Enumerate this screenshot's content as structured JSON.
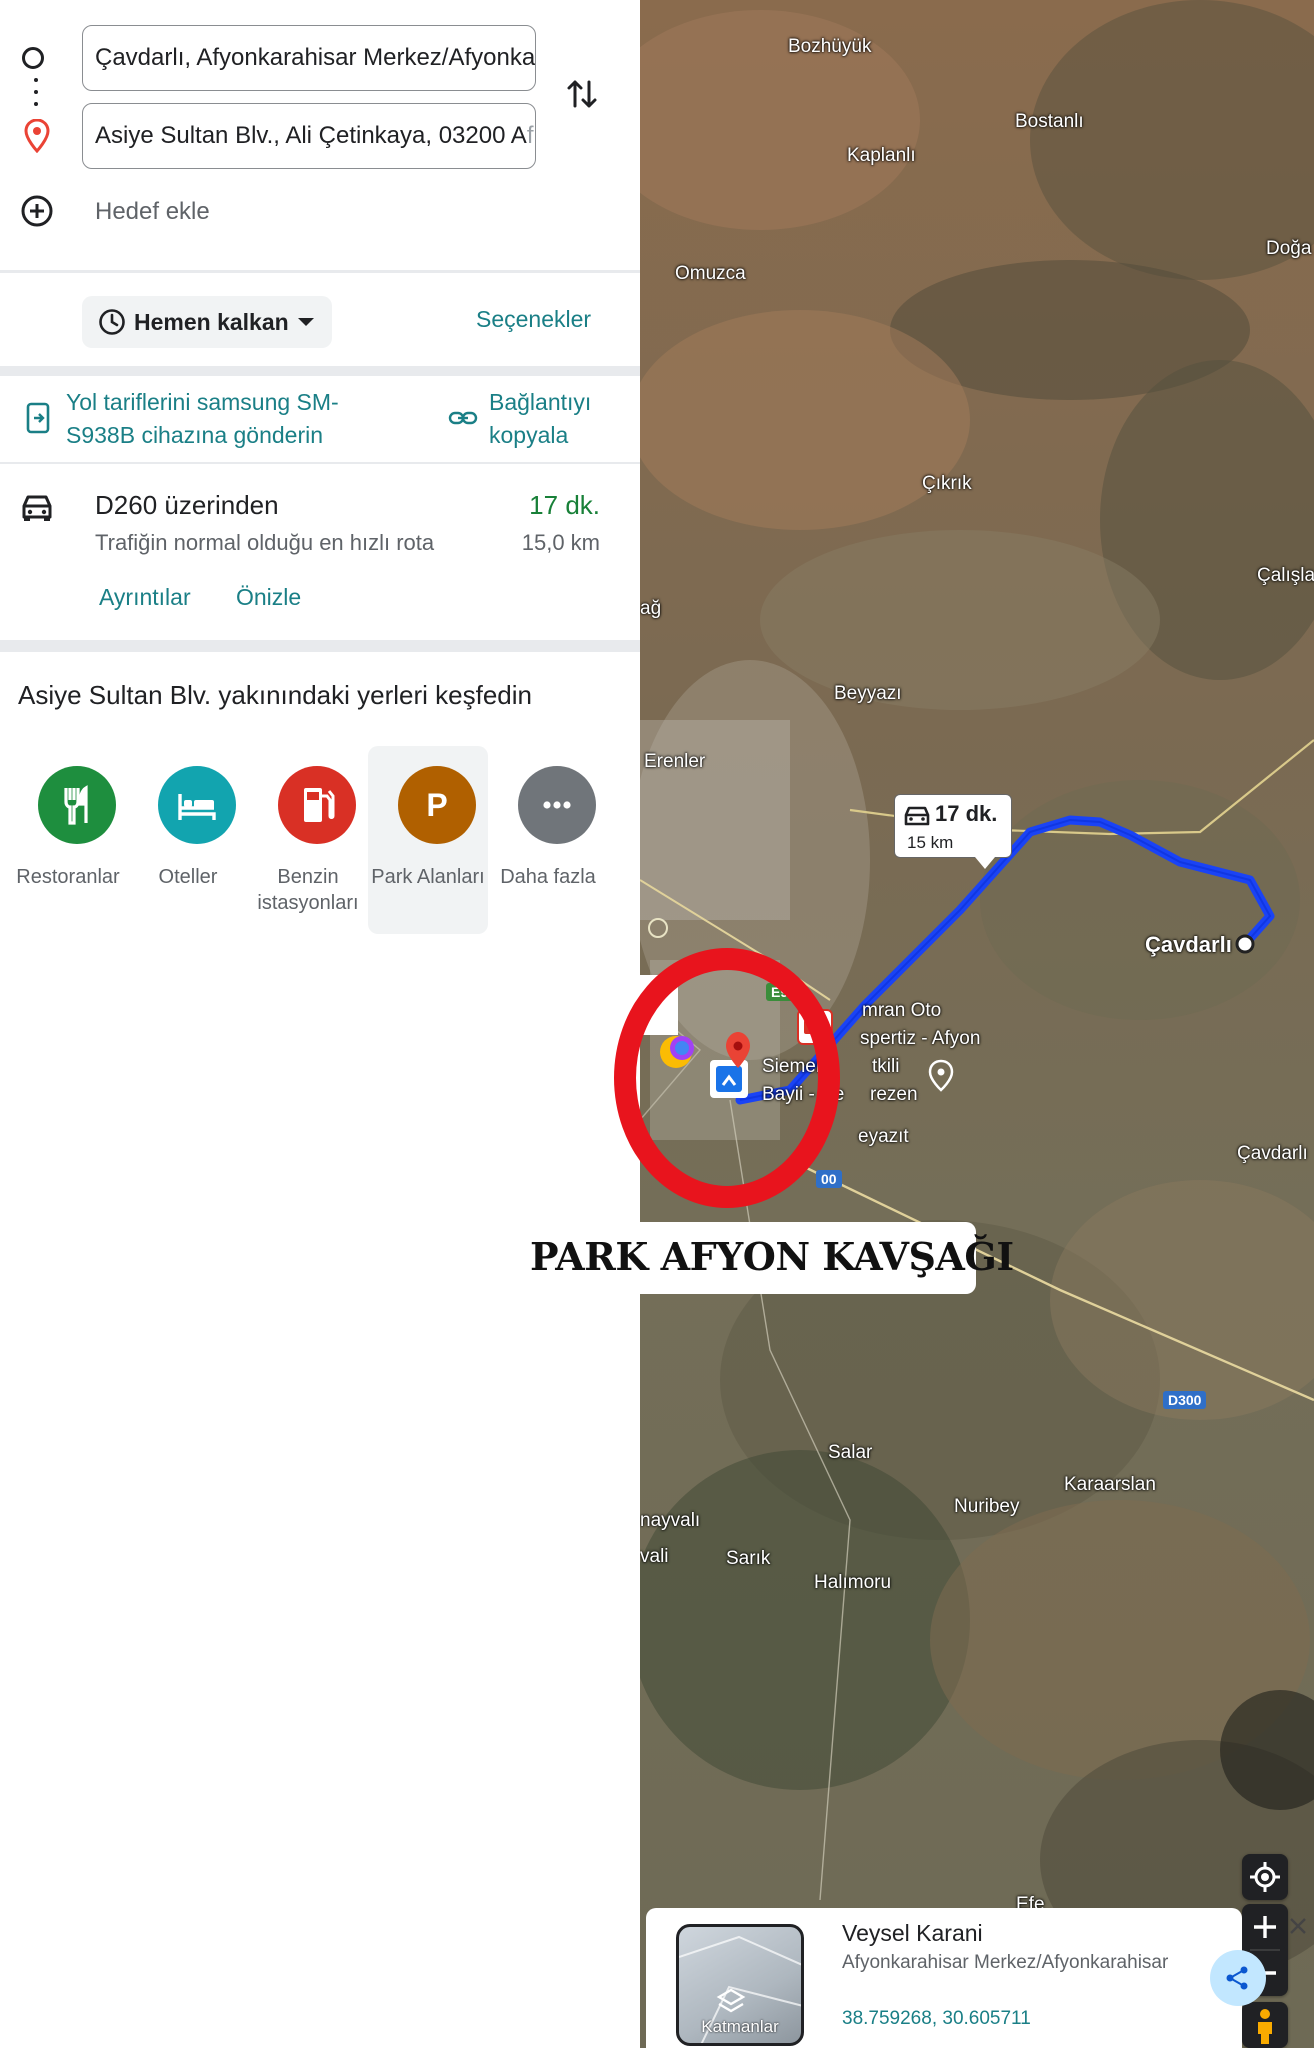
{
  "directions": {
    "origin_value": "Çavdarlı, Afyonkarahisar Merkez/Afyonka",
    "origin_fade": "ra",
    "destination_value": "Asiye Sultan Blv., Ali Çetinkaya, 03200 A",
    "destination_fade": "f",
    "add_destination_label": "Hedef ekle"
  },
  "departure": {
    "button_label": "Hemen kalkan",
    "options_label": "Seçenekler"
  },
  "share": {
    "send_label": "Yol tariflerini samsung SM-S938B cihazına gönderin",
    "copy_link_label": "Bağlantıyı kopyala"
  },
  "route": {
    "via": "D260 üzerinden",
    "duration": "17 dk.",
    "subtitle": "Trafiğin normal olduğu en hızlı rota",
    "distance": "15,0 km",
    "details_label": "Ayrıntılar",
    "preview_label": "Önizle"
  },
  "explore": {
    "title": "Asiye Sultan Blv. yakınındaki yerleri keşfedin",
    "categories": [
      {
        "label": "Restoranlar",
        "color": "#1e8e3e",
        "icon": "fork-knife-icon"
      },
      {
        "label": "Oteller",
        "color": "#12a4af",
        "icon": "bed-icon"
      },
      {
        "label": "Benzin istasyonları",
        "color": "#d93025",
        "icon": "fuel-icon"
      },
      {
        "label": "Park Alanları",
        "color": "#b06000",
        "icon": "parking-icon",
        "selected": true
      },
      {
        "label": "Daha fazla",
        "color": "#70757a",
        "icon": "more-icon"
      }
    ]
  },
  "map": {
    "places": [
      "Bozhüyük",
      "Bostanlı",
      "Kaplanlı",
      "Doğa",
      "Omuzca",
      "Çıkrık",
      "Çalışla",
      "ağ",
      "Beyyazı",
      "Erenler",
      "Çavdarlı",
      "Çavdarlı",
      "mran Oto",
      "spertiz - Afyon",
      "Siemens",
      "tkili",
      "Bayii - De",
      "rezen",
      "eyazıt",
      "Salar",
      "Karaarslan",
      "Nuribey",
      "nayvalı",
      "vali",
      "Sarık",
      "Halımoru",
      "Efe"
    ],
    "route_bubble_duration": "17 dk.",
    "route_bubble_distance": "15 km",
    "road_badges": [
      "E96",
      "D300",
      "00"
    ],
    "route_color": "#1a43f5"
  },
  "info_card": {
    "layers_label": "Katmanlar",
    "name": "Veysel Karani",
    "address": "Afyonkarahisar Merkez/Afyonkarahisar",
    "coords": "38.759268, 30.605711"
  },
  "annotation": {
    "caption": "PARK AFYON KAVŞAĞI",
    "ring_color": "#e8141d"
  }
}
